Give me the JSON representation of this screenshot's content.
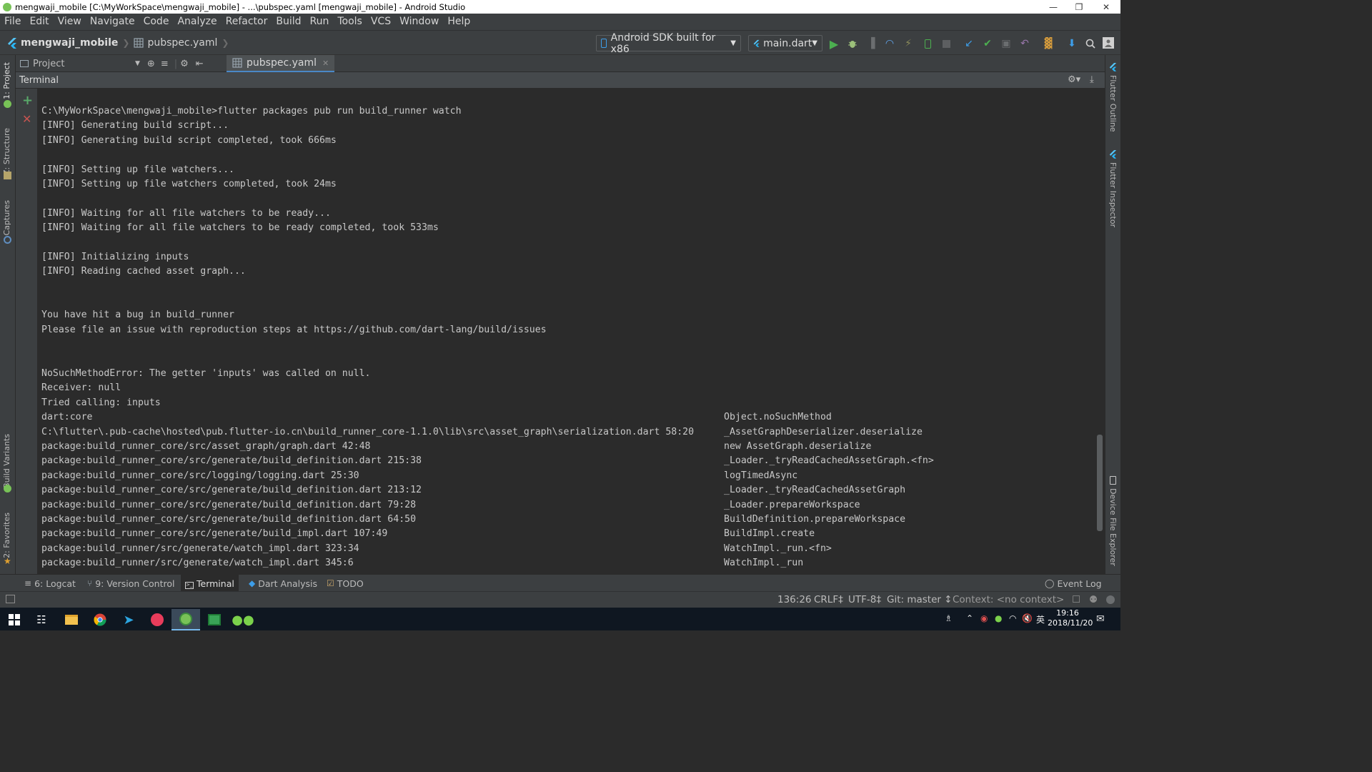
{
  "window": {
    "title": "mengwaji_mobile [C:\\MyWorkSpace\\mengwaji_mobile] - ...\\pubspec.yaml [mengwaji_mobile] - Android Studio",
    "controls": [
      "minimize",
      "restore",
      "close"
    ]
  },
  "menu": [
    "File",
    "Edit",
    "View",
    "Navigate",
    "Code",
    "Analyze",
    "Refactor",
    "Build",
    "Run",
    "Tools",
    "VCS",
    "Window",
    "Help"
  ],
  "breadcrumb": {
    "project": "mengwaji_mobile",
    "file": "pubspec.yaml"
  },
  "toolbar": {
    "device": "Android SDK built for x86",
    "run_config": "main.dart",
    "icons": [
      "run-icon",
      "debug-icon",
      "attach-icon",
      "profile-icon",
      "hot-reload-icon",
      "apply-changes-icon",
      "stop-icon",
      "flutter-icon",
      "vcs-update-icon",
      "vcs-commit-icon",
      "revert-icon",
      "sdk-manager-icon",
      "avd-manager-icon",
      "search-icon",
      "user-icon"
    ],
    "accent": "#4caf50"
  },
  "left_tool_tabs": [
    "1: Project",
    "Z: Structure",
    "Captures",
    "Build Variants",
    "2: Favorites"
  ],
  "right_tool_tabs": [
    "Flutter Outline",
    "Flutter Inspector",
    "Device File Explorer"
  ],
  "project_panel": {
    "title": "Project"
  },
  "editor_tab": {
    "label": "pubspec.yaml"
  },
  "terminal": {
    "title": "Terminal",
    "lines": [
      {
        "t": "C:\\MyWorkSpace\\mengwaji_mobile>flutter packages pub run build_runner watch",
        "r": ""
      },
      {
        "t": "[INFO] Generating build script...",
        "r": ""
      },
      {
        "t": "[INFO] Generating build script completed, took 666ms",
        "r": ""
      },
      {
        "t": "",
        "r": ""
      },
      {
        "t": "[INFO] Setting up file watchers...",
        "r": ""
      },
      {
        "t": "[INFO] Setting up file watchers completed, took 24ms",
        "r": ""
      },
      {
        "t": "",
        "r": ""
      },
      {
        "t": "[INFO] Waiting for all file watchers to be ready...",
        "r": ""
      },
      {
        "t": "[INFO] Waiting for all file watchers to be ready completed, took 533ms",
        "r": ""
      },
      {
        "t": "",
        "r": ""
      },
      {
        "t": "[INFO] Initializing inputs",
        "r": ""
      },
      {
        "t": "[INFO] Reading cached asset graph...",
        "r": ""
      },
      {
        "t": "",
        "r": ""
      },
      {
        "t": "",
        "r": ""
      },
      {
        "t": "You have hit a bug in build_runner",
        "r": ""
      },
      {
        "t": "Please file an issue with reproduction steps at https://github.com/dart-lang/build/issues",
        "r": ""
      },
      {
        "t": "",
        "r": ""
      },
      {
        "t": "",
        "r": ""
      },
      {
        "t": "NoSuchMethodError: The getter 'inputs' was called on null.",
        "r": ""
      },
      {
        "t": "Receiver: null",
        "r": ""
      },
      {
        "t": "Tried calling: inputs",
        "r": ""
      },
      {
        "t": "dart:core",
        "r": "Object.noSuchMethod"
      },
      {
        "t": "C:\\flutter\\.pub-cache\\hosted\\pub.flutter-io.cn\\build_runner_core-1.1.0\\lib\\src\\asset_graph\\serialization.dart 58:20",
        "r": "_AssetGraphDeserializer.deserialize"
      },
      {
        "t": "package:build_runner_core/src/asset_graph/graph.dart 42:48",
        "r": "new AssetGraph.deserialize"
      },
      {
        "t": "package:build_runner_core/src/generate/build_definition.dart 215:38",
        "r": "_Loader._tryReadCachedAssetGraph.<fn>"
      },
      {
        "t": "package:build_runner_core/src/logging/logging.dart 25:30",
        "r": "logTimedAsync"
      },
      {
        "t": "package:build_runner_core/src/generate/build_definition.dart 213:12",
        "r": "_Loader._tryReadCachedAssetGraph"
      },
      {
        "t": "package:build_runner_core/src/generate/build_definition.dart 79:28",
        "r": "_Loader.prepareWorkspace"
      },
      {
        "t": "package:build_runner_core/src/generate/build_definition.dart 64:50",
        "r": "BuildDefinition.prepareWorkspace"
      },
      {
        "t": "package:build_runner_core/src/generate/build_impl.dart 107:49",
        "r": "BuildImpl.create"
      },
      {
        "t": "package:build_runner/src/generate/watch_impl.dart 323:34",
        "r": "WatchImpl._run.<fn>"
      },
      {
        "t": "package:build_runner/src/generate/watch_impl.dart 345:6",
        "r": "WatchImpl._run"
      }
    ]
  },
  "bottom_tabs": [
    {
      "label": "6: Logcat",
      "icon": "logcat-icon",
      "active": false
    },
    {
      "label": "9: Version Control",
      "icon": "version-control-icon",
      "active": false
    },
    {
      "label": "Terminal",
      "icon": "terminal-icon",
      "active": true
    },
    {
      "label": "Dart Analysis",
      "icon": "dart-icon",
      "active": false
    },
    {
      "label": "TODO",
      "icon": "todo-icon",
      "active": false
    }
  ],
  "event_log": "Event Log",
  "status": {
    "position": "136:26",
    "line_sep": "CRLF‡",
    "encoding": "UTF-8‡",
    "git": "Git: master ↕",
    "context": "Context: <no context>"
  },
  "taskbar": {
    "apps": [
      "windows-start-icon",
      "task-view-icon",
      "file-explorer-icon",
      "chrome-icon",
      "telegram-icon",
      "music-app-icon",
      "android-studio-icon",
      "green-app-icon",
      "wechat-icon"
    ],
    "ime": "英",
    "time": "19:16",
    "date": "2018/11/20"
  }
}
